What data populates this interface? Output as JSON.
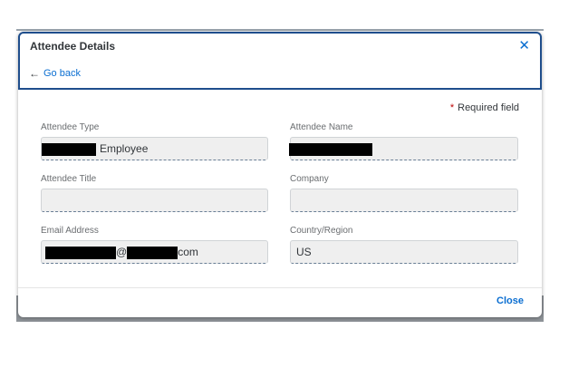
{
  "dialog": {
    "title": "Attendee Details",
    "close_icon": "✕",
    "go_back_label": "Go back",
    "back_icon": "←",
    "required_star": "*",
    "required_note": "Required field",
    "footer_close_label": "Close"
  },
  "fields": {
    "attendee_type": {
      "label": "Attendee Type",
      "value": "Employee"
    },
    "attendee_name": {
      "label": "Attendee Name",
      "value": ""
    },
    "attendee_title": {
      "label": "Attendee Title",
      "value": ""
    },
    "company": {
      "label": "Company",
      "value": ""
    },
    "email": {
      "label": "Email Address",
      "at": "@",
      "suffix": "com"
    },
    "country": {
      "label": "Country/Region",
      "value": "US"
    }
  },
  "colors": {
    "link": "#0a6ed1",
    "header_border": "#1f4e8c",
    "required": "#bb0000"
  }
}
